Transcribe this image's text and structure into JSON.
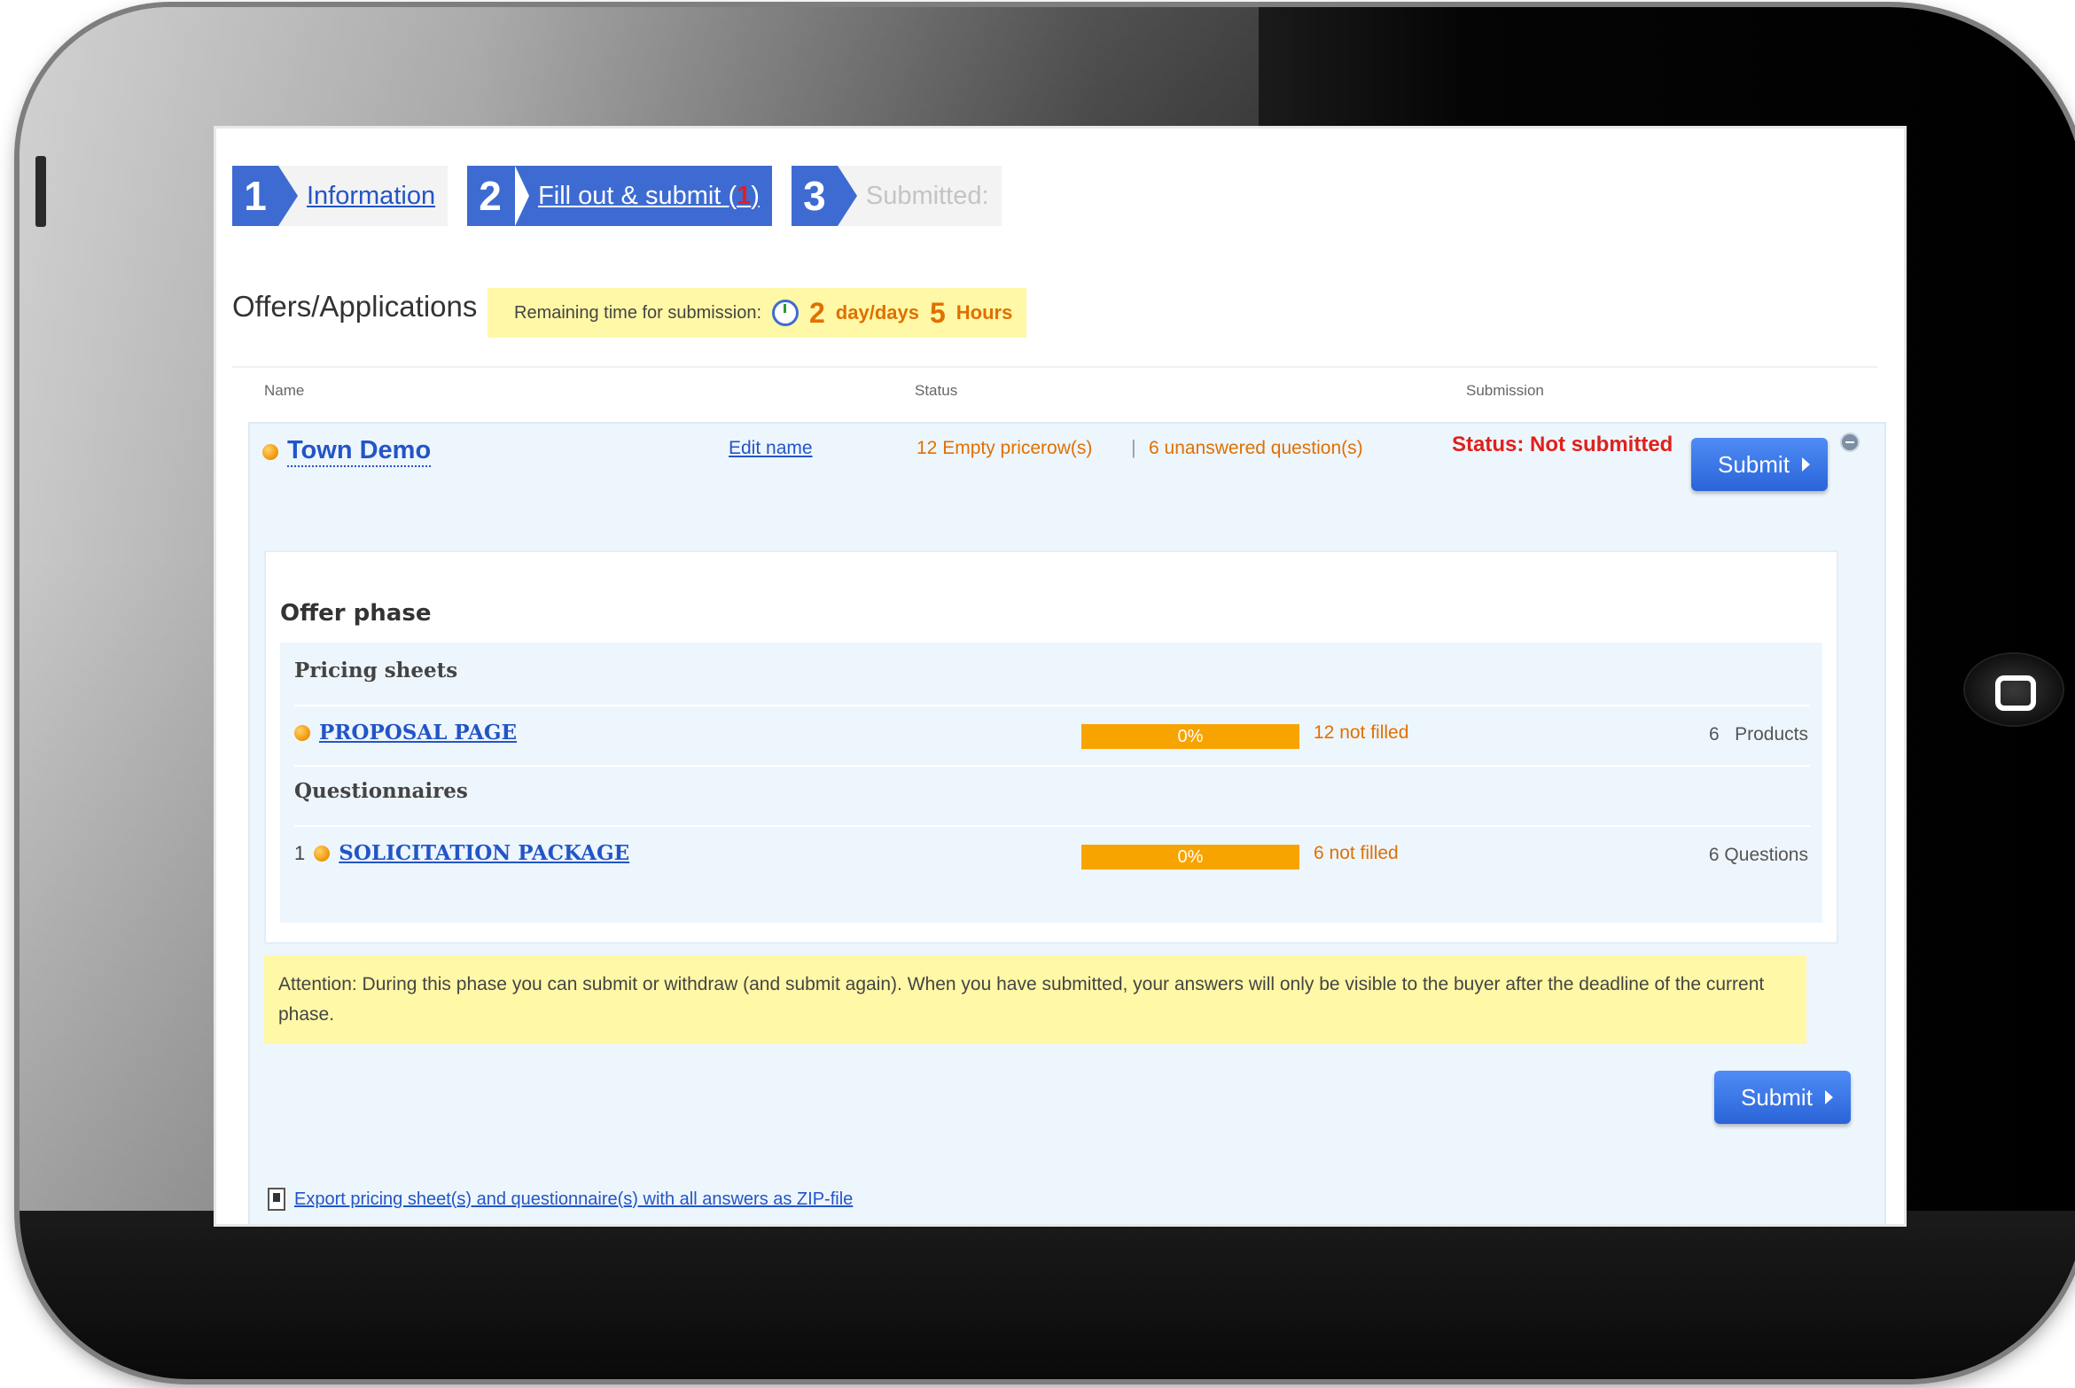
{
  "steps": [
    {
      "num": "1",
      "label": "Information"
    },
    {
      "num": "2",
      "label": "Fill out & submit",
      "badge_open": "(",
      "badge": "1",
      "badge_close": ")"
    },
    {
      "num": "3",
      "label": "Submitted:"
    }
  ],
  "page_title": "Offers/Applications",
  "remaining": {
    "label": "Remaining time for submission:",
    "days_value": "2",
    "days_unit": "day/days",
    "hours_value": "5",
    "hours_unit": "Hours"
  },
  "table_header": {
    "name": "Name",
    "status": "Status",
    "submission": "Submission"
  },
  "offer": {
    "name": "Town Demo",
    "edit_label": "Edit name",
    "empty_pricerows": "12 Empty pricerow(s)",
    "separator": "|",
    "unanswered": "6 unanswered question(s)",
    "submission_status": "Status: Not submitted",
    "submit_label": "Submit"
  },
  "phase": {
    "title": "Offer phase",
    "pricing_title": "Pricing sheets",
    "pricing_item": {
      "name": "PROPOSAL PAGE",
      "progress_label": "0%",
      "progress": 0,
      "not_filled": "12 not filled",
      "count": "6   Products"
    },
    "questionnaires_title": "Questionnaires",
    "questionnaire_item": {
      "index": "1",
      "name": "SOLICITATION PACKAGE",
      "progress_label": "0%",
      "progress": 0,
      "not_filled": "6 not filled",
      "count": "6 Questions"
    }
  },
  "attention": "Attention: During this phase you can submit or withdraw (and submit again). When you have submitted, your answers will only be visible to the buyer after the deadline of the current phase.",
  "bottom_submit_label": "Submit",
  "export_label": "Export pricing sheet(s) and questionnaire(s) with all answers as ZIP-file",
  "colors": {
    "accent": "#3d6bd2",
    "warning": "#e07000",
    "error": "#e0201a",
    "progress": "#f7a400",
    "highlight": "#fff8a6"
  }
}
